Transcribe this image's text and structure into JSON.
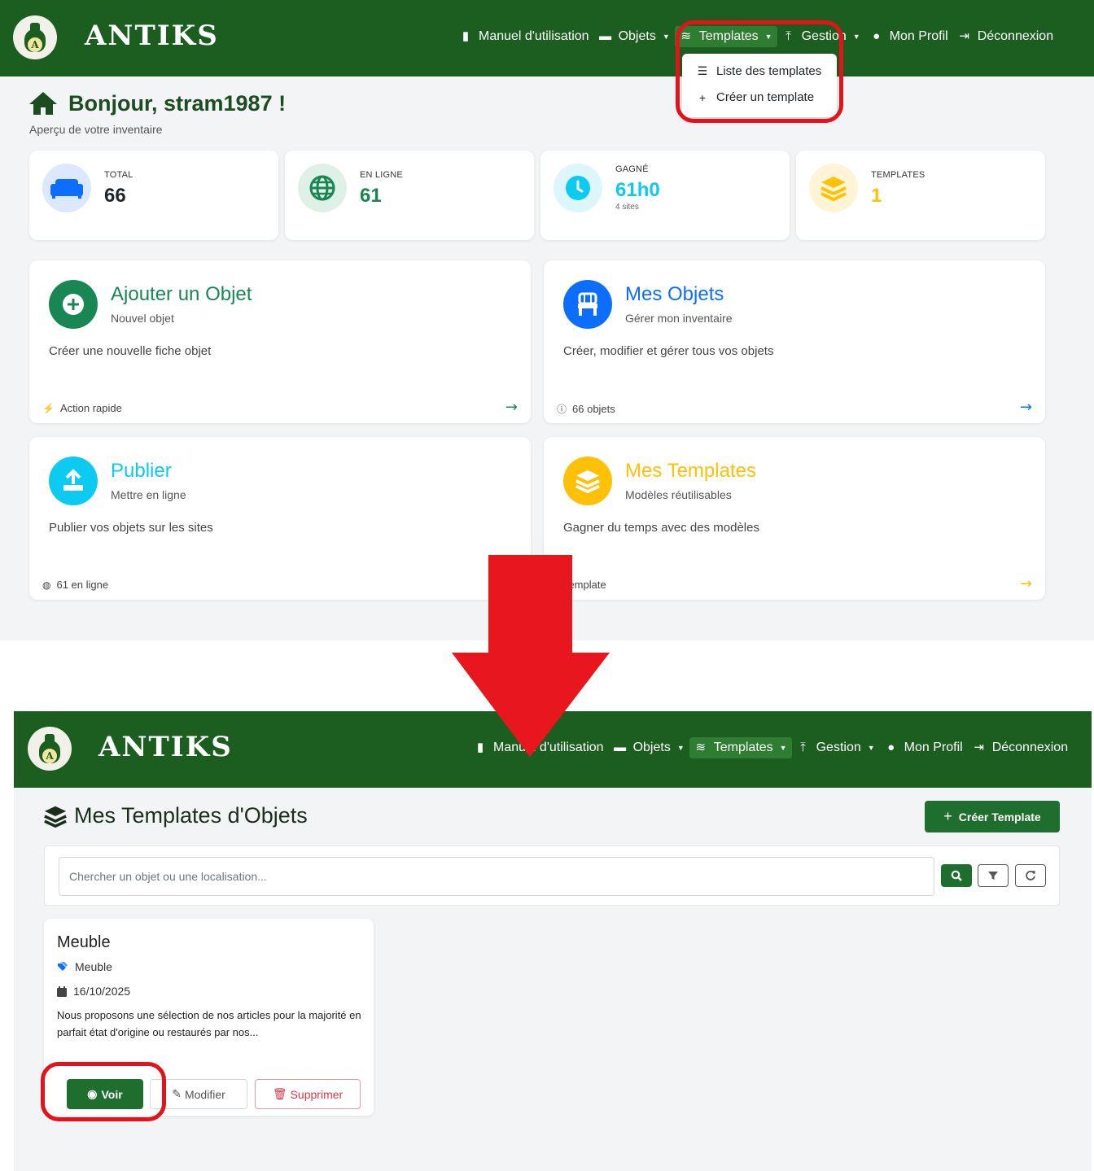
{
  "colors": {
    "nav_green": "#1b5e20",
    "highlight_red": "#e3131b",
    "card_green": "#198754",
    "blue": "#0d6efd",
    "cyan": "#0dcaf0",
    "yellow": "#ffc107"
  },
  "brand": {
    "name": "ANTIKS",
    "logo_letter": "A"
  },
  "nav": {
    "manual": "Manuel d'utilisation",
    "objets": "Objets",
    "templates": "Templates",
    "gestion": "Gestion",
    "profil": "Mon Profil",
    "logout": "Déconnexion"
  },
  "dropdown": {
    "list_templates": "Liste des templates",
    "create_template": "Créer un template"
  },
  "dashboard": {
    "greeting": "Bonjour, stram1987 !",
    "subtitle": "Aperçu de votre inventaire",
    "stats": [
      {
        "label": "TOTAL",
        "value": "66",
        "extra": "",
        "color": "#212529",
        "icon": "sofa-icon"
      },
      {
        "label": "EN LIGNE",
        "value": "61",
        "extra": "",
        "color": "#198754",
        "icon": "globe-icon"
      },
      {
        "label": "GAGNÉ",
        "value": "61h0",
        "extra": "4 sites",
        "color": "#0dcaf0",
        "icon": "clock-icon"
      },
      {
        "label": "TEMPLATES",
        "value": "1",
        "extra": "",
        "color": "#ffc107",
        "icon": "layers-icon"
      }
    ],
    "cards": [
      {
        "title": "Ajouter un Objet",
        "subtitle": "Nouvel objet",
        "desc": "Créer une nouvelle fiche objet",
        "footer": "Action rapide",
        "color": "#198754",
        "icon": "plus-circle-icon"
      },
      {
        "title": "Mes Objets",
        "subtitle": "Gérer mon inventaire",
        "desc": "Créer, modifier et gérer tous vos objets",
        "footer": "66 objets",
        "color": "#0d6efd",
        "icon": "chair-icon"
      },
      {
        "title": "Publier",
        "subtitle": "Mettre en ligne",
        "desc": "Publier vos objets sur les sites",
        "footer": "61 en ligne",
        "color": "#0dcaf0",
        "icon": "upload-icon"
      },
      {
        "title": "Mes Templates",
        "subtitle": "Modèles réutilisables",
        "desc": "Gagner du temps avec des modèles",
        "footer": "1 template",
        "color": "#ffc107",
        "icon": "layers-icon"
      }
    ]
  },
  "templates_page": {
    "title": "Mes Templates d'Objets",
    "create_button": "Créer Template",
    "search_placeholder": "Chercher un objet ou une localisation...",
    "template": {
      "name": "Meuble",
      "category": "Meuble",
      "date": "16/10/2025",
      "description": "Nous proposons une sélection de nos articles pour la majorité en parfait état d'origine ou restaurés par nos...",
      "view": "Voir",
      "edit": "Modifier",
      "delete": "Supprimer"
    }
  }
}
